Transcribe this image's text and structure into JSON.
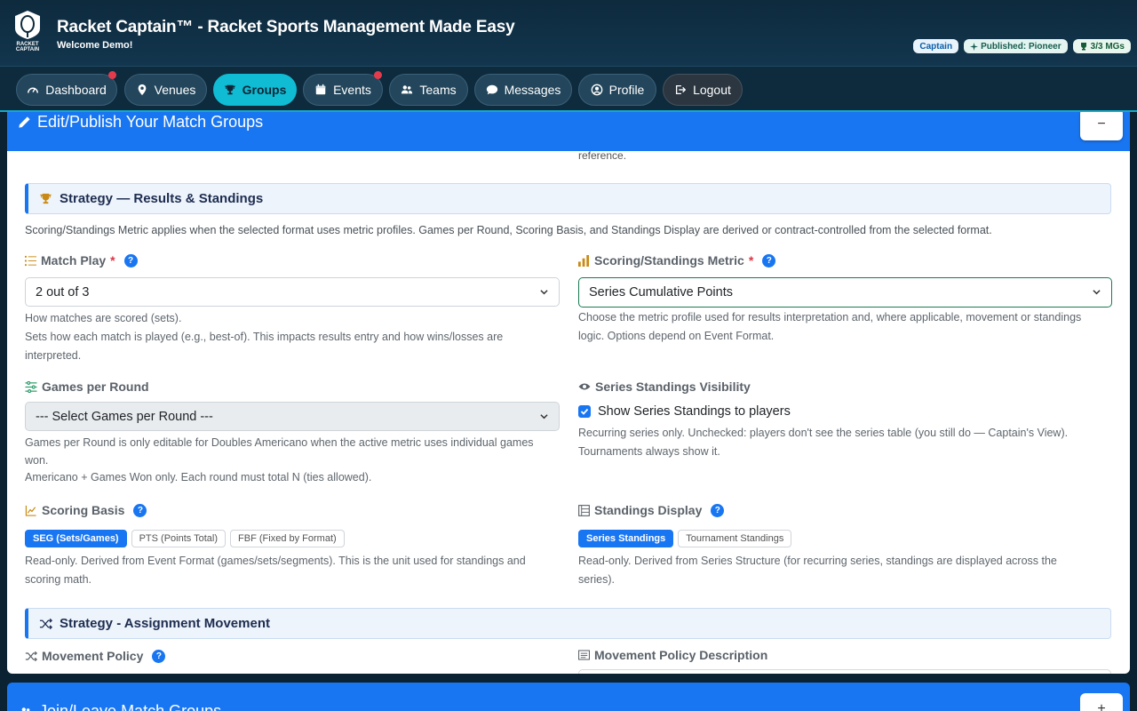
{
  "header": {
    "logo_text": "RACKET CAPTAIN",
    "title": "Racket Captain™ - Racket Sports Management Made Easy",
    "welcome": "Welcome Demo!",
    "badges": {
      "role": "Captain",
      "published": "Published: Pioneer",
      "mgs": "3/3 MGs"
    }
  },
  "nav": {
    "dashboard": "Dashboard",
    "venues": "Venues",
    "groups": "Groups",
    "events": "Events",
    "teams": "Teams",
    "messages": "Messages",
    "profile": "Profile",
    "logout": "Logout",
    "active": "Groups"
  },
  "card": {
    "title": "Edit/Publish Your Match Groups",
    "collapse_label": "−",
    "reference_text": "reference."
  },
  "results_section": {
    "title": "Strategy — Results & Standings",
    "note": "Scoring/Standings Metric applies when the selected format uses metric profiles. Games per Round, Scoring Basis, and Standings Display are derived or contract-controlled from the selected format."
  },
  "match_play": {
    "label": "Match Play",
    "required": "*",
    "value": "2 out of 3",
    "help1": "How matches are scored (sets).",
    "help2": "Sets how each match is played (e.g., best-of). This impacts results entry and how wins/losses are",
    "help3": "interpreted."
  },
  "metric": {
    "label": "Scoring/Standings Metric",
    "required": "*",
    "value": "Series Cumulative Points",
    "help1": "Choose the metric profile used for results interpretation and, where applicable, movement or standings",
    "help2": "logic. Options depend on Event Format."
  },
  "games_per_round": {
    "label": "Games per Round",
    "value": "--- Select Games per Round ---",
    "help1": "Games per Round is only editable for Doubles Americano when the active metric uses individual games",
    "help2": "won.",
    "help3": "Americano + Games Won only. Each round must total N (ties allowed)."
  },
  "series_visibility": {
    "label": "Series Standings Visibility",
    "checkbox_label": "Show Series Standings to players",
    "checked": true,
    "help1": "Recurring series only. Unchecked: players don't see the series table (you still do — Captain's View).",
    "help2": "Tournaments always show it."
  },
  "scoring_basis": {
    "label": "Scoring Basis",
    "options": [
      "SEG (Sets/Games)",
      "PTS (Points Total)",
      "FBF (Fixed by Format)"
    ],
    "selected": "SEG (Sets/Games)",
    "help1": "Read-only. Derived from Event Format (games/sets/segments). This is the unit used for standings and",
    "help2": "scoring math."
  },
  "standings_display": {
    "label": "Standings Display",
    "options": [
      "Series Standings",
      "Tournament Standings"
    ],
    "selected": "Series Standings",
    "help1": "Read-only. Derived from Series Structure (for recurring series, standings are displayed across the",
    "help2": "series)."
  },
  "movement_section": {
    "title": "Strategy - Assignment Movement",
    "policy_label": "Movement Policy",
    "description_label": "Movement Policy Description"
  },
  "card2": {
    "title": "Join/Leave Match Groups",
    "expand_label": "+"
  },
  "colors": {
    "primary": "#1976f2",
    "nav_active": "#10bcd3",
    "header_bg": "#0e2a3d",
    "danger": "#dc3545"
  }
}
